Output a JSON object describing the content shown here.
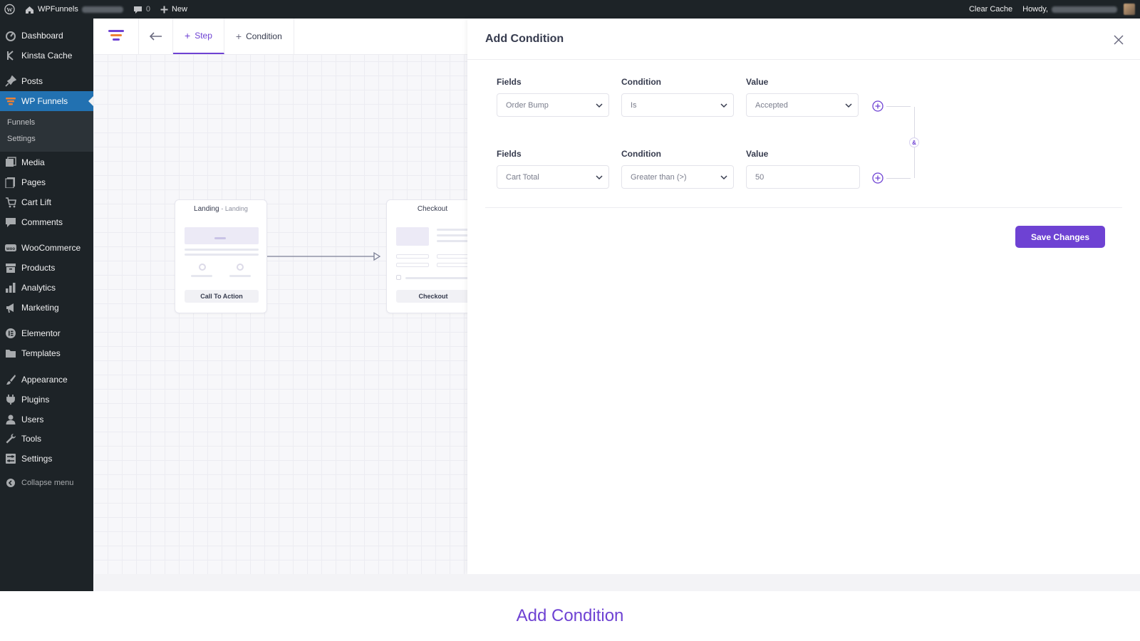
{
  "admin_bar": {
    "site_name": "WPFunnels",
    "comments_count": "0",
    "new_label": "New",
    "clear_cache": "Clear Cache",
    "howdy": "Howdy,"
  },
  "sidebar": {
    "items": [
      {
        "label": "Dashboard",
        "icon": "dashboard-icon"
      },
      {
        "label": "Kinsta Cache",
        "icon": "kinsta-icon"
      },
      {
        "label": "Posts",
        "icon": "pin-icon"
      },
      {
        "label": "WP Funnels",
        "icon": "funnel-icon"
      },
      {
        "label": "Media",
        "icon": "media-icon"
      },
      {
        "label": "Pages",
        "icon": "pages-icon"
      },
      {
        "label": "Cart Lift",
        "icon": "cart-icon"
      },
      {
        "label": "Comments",
        "icon": "comment-icon"
      },
      {
        "label": "WooCommerce",
        "icon": "woo-icon"
      },
      {
        "label": "Products",
        "icon": "archive-icon"
      },
      {
        "label": "Analytics",
        "icon": "bars-icon"
      },
      {
        "label": "Marketing",
        "icon": "megaphone-icon"
      },
      {
        "label": "Elementor",
        "icon": "elementor-icon"
      },
      {
        "label": "Templates",
        "icon": "folder-icon"
      },
      {
        "label": "Appearance",
        "icon": "brush-icon"
      },
      {
        "label": "Plugins",
        "icon": "plug-icon"
      },
      {
        "label": "Users",
        "icon": "user-icon"
      },
      {
        "label": "Tools",
        "icon": "wrench-icon"
      },
      {
        "label": "Settings",
        "icon": "settings-icon"
      }
    ],
    "submenu": [
      "Funnels",
      "Settings"
    ],
    "collapse": "Collapse menu"
  },
  "toolbar": {
    "step_label": "Step",
    "condition_label": "Condition"
  },
  "nodes": {
    "landing": {
      "title": "Landing",
      "subtitle": "Landing",
      "button": "Call To Action"
    },
    "checkout": {
      "title": "Checkout",
      "button": "Checkout"
    }
  },
  "panel": {
    "title": "Add Condition",
    "rows": [
      {
        "fields_label": "Fields",
        "condition_label": "Condition",
        "value_label": "Value",
        "field": "Order Bump",
        "condition": "Is",
        "value": "Accepted"
      },
      {
        "fields_label": "Fields",
        "condition_label": "Condition",
        "value_label": "Value",
        "field": "Cart Total",
        "condition": "Greater than (>)",
        "value": "50"
      }
    ],
    "and_label": "&",
    "save_label": "Save Changes"
  },
  "caption": "Add Condition",
  "colors": {
    "accent": "#6e42d3",
    "wp_dark": "#1d2327",
    "wp_blue": "#2271b1"
  }
}
